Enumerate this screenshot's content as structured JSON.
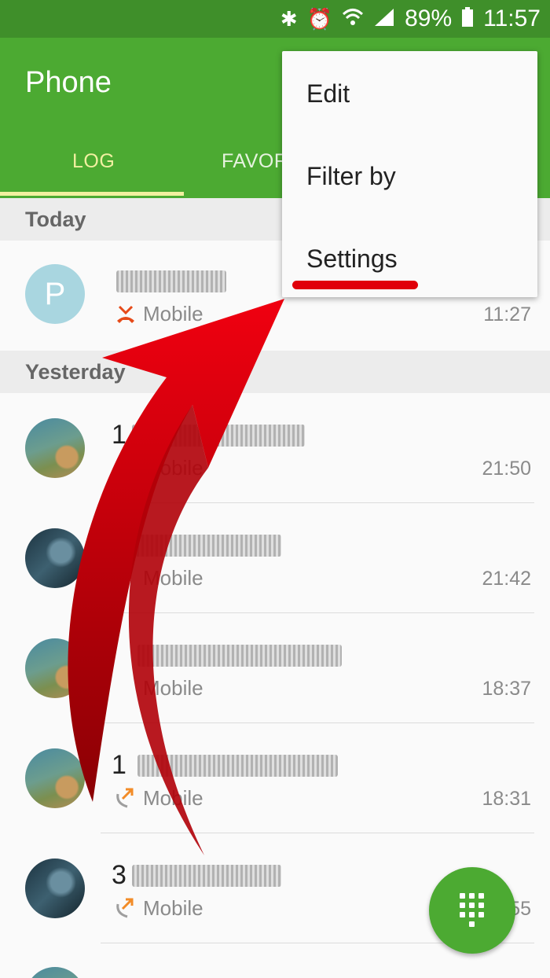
{
  "status_bar": {
    "battery": "89%",
    "time": "11:57",
    "icons": [
      "bluetooth-icon",
      "alarm-icon",
      "wifi-icon",
      "signal-icon",
      "battery-icon"
    ]
  },
  "app": {
    "title": "Phone"
  },
  "tabs": [
    {
      "label": "LOG",
      "active": true
    },
    {
      "label": "FAVOR",
      "active": false
    }
  ],
  "sections": {
    "today": "Today",
    "yesterday": "Yesterday"
  },
  "calls": [
    {
      "avatar_letter": "P",
      "name_prefix": "",
      "type": "Mobile",
      "time": "11:27",
      "call_icon": "missed-call-icon"
    },
    {
      "name_prefix": "1",
      "type": "Mobile",
      "time": "21:50",
      "call_icon": "outgoing-call-icon"
    },
    {
      "name_prefix": "3",
      "type": "Mobile",
      "time": "21:42",
      "call_icon": "incoming-call-icon"
    },
    {
      "name_prefix": "",
      "type": "Mobile",
      "time": "18:37",
      "call_icon": "outgoing-call-icon"
    },
    {
      "name_prefix": "1",
      "type": "Mobile",
      "time": "18:31",
      "call_icon": "outgoing-call-icon"
    },
    {
      "name_prefix": "3",
      "type": "Mobile",
      "time": "55",
      "call_icon": "outgoing-call-icon"
    }
  ],
  "menu": {
    "items": [
      "Edit",
      "Filter by",
      "Settings"
    ]
  },
  "colors": {
    "accent": "#4caa32",
    "status_bar": "#3f8f2a",
    "tab_active": "#f1f0a0",
    "annotation": "#e0000a"
  }
}
